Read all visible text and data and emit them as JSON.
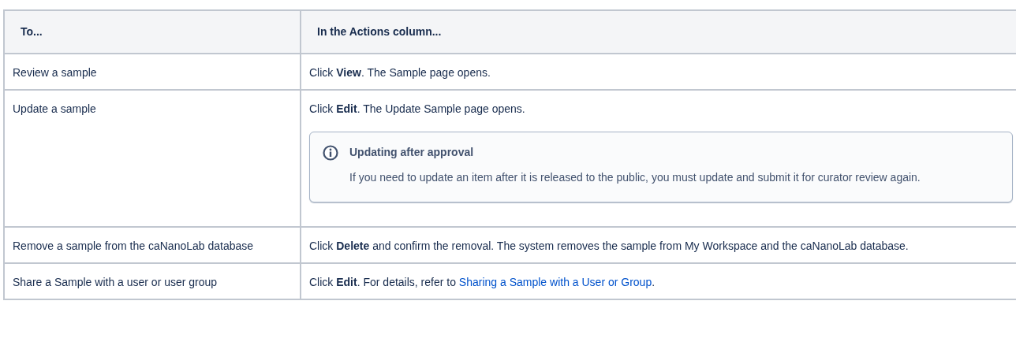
{
  "table": {
    "columns": [
      "To...",
      "In the Actions column..."
    ],
    "rows": [
      {
        "task": "Review a sample",
        "action": "Click **View**. The Sample page opens."
      },
      {
        "task": "Update a sample",
        "action": "Click **Edit**. The Update Sample page opens.",
        "note": {
          "title": "Updating after approval",
          "body": "If you need to update an item after it is released to the public, you must update and submit it for curator review again."
        }
      },
      {
        "task": "Remove a sample from the caNanoLab database",
        "action": "Click **Delete** and confirm the removal. The system removes the sample from My Workspace and the caNanoLab database."
      },
      {
        "task": "Share a Sample with a user or user group",
        "action": "Click **Edit**. For details, refer to ",
        "link": "Sharing a Sample with a User or Group",
        "suffix": "."
      }
    ]
  }
}
